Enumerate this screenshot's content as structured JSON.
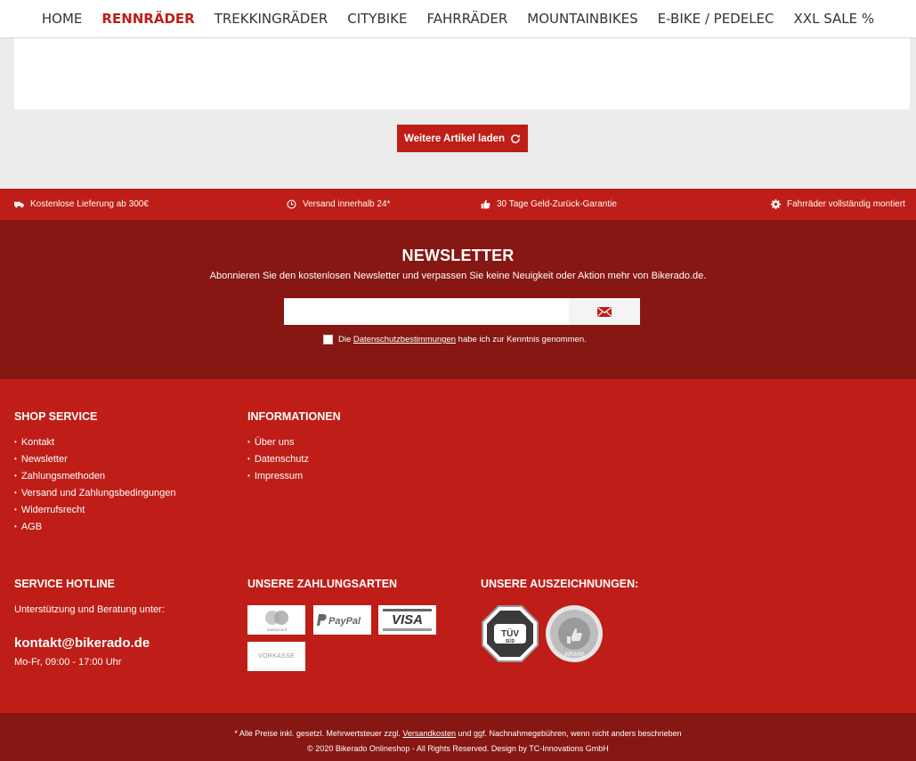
{
  "nav": {
    "items": [
      "HOME",
      "RENNRÄDER",
      "TREKKINGRÄDER",
      "CITYBIKE",
      "FAHRRÄDER",
      "MOUNTAINBIKES",
      "E-BIKE / PEDELEC",
      "XXL SALE %"
    ],
    "active": "RENNRÄDER"
  },
  "content": {
    "load_more_label": "Weitere Artikel laden"
  },
  "benefits": [
    {
      "icon": "truck-icon",
      "text": "Kostenlose Lieferung ab 300€"
    },
    {
      "icon": "clock-icon",
      "text": "Versand innerhalb 24*"
    },
    {
      "icon": "thumbs-up-icon",
      "text": "30 Tage Geld-Zurück-Garantie"
    },
    {
      "icon": "gear-icon",
      "text": "Fahrräder vollständig montiert"
    }
  ],
  "newsletter": {
    "title": "NEWSLETTER",
    "subtitle": "Abonnieren Sie den kostenlosen Newsletter und verpassen Sie keine Neuigkeit oder Aktion mehr von Bikerado.de.",
    "input_value": "",
    "consent_prefix": "Die",
    "consent_link": "Datenschutzbestimmungen",
    "consent_suffix": "habe ich zur Kenntnis genommen."
  },
  "footer": {
    "shop_service": {
      "title": "SHOP SERVICE",
      "items": [
        "Kontakt",
        "Newsletter",
        "Zahlungsmethoden",
        "Versand und Zahlungsbedingungen",
        "Widerrufsrecht",
        "AGB"
      ]
    },
    "informationen": {
      "title": "INFORMATIONEN",
      "items": [
        "Über uns",
        "Datenschutz",
        "Impressum"
      ]
    },
    "hotline": {
      "title": "SERVICE HOTLINE",
      "text": "Unterstützung und Beratung unter:",
      "email": "kontakt@bikerado.de",
      "hours": "Mo-Fr, 09:00 - 17:00 Uhr"
    },
    "payments": {
      "title": "UNSERE ZAHLUNGSARTEN",
      "methods": [
        "mastercard",
        "PayPal",
        "VISA",
        "VORKASSE"
      ]
    },
    "awards": {
      "title": "UNSERE AUSZEICHNUNGEN:",
      "badges": [
        "TÜV SÜD",
        "THE FEEDBACK COMPANY eKomi"
      ]
    }
  },
  "bottom": {
    "note_prefix": "* Alle Preise inkl. gesetzl. Mehrwertsteuer zzgl.",
    "note_link": "Versandkosten",
    "note_suffix": "und ggf. Nachnahmegebühren, wenn nicht anders beschrieben",
    "copyright": "© 2020 Bikerado Onlineshop - All Rights Reserved. Design by TC-Innovations GmbH"
  },
  "colors": {
    "brand_red": "#be1e17",
    "dark_red": "#861712",
    "page_grey": "#ececec"
  }
}
